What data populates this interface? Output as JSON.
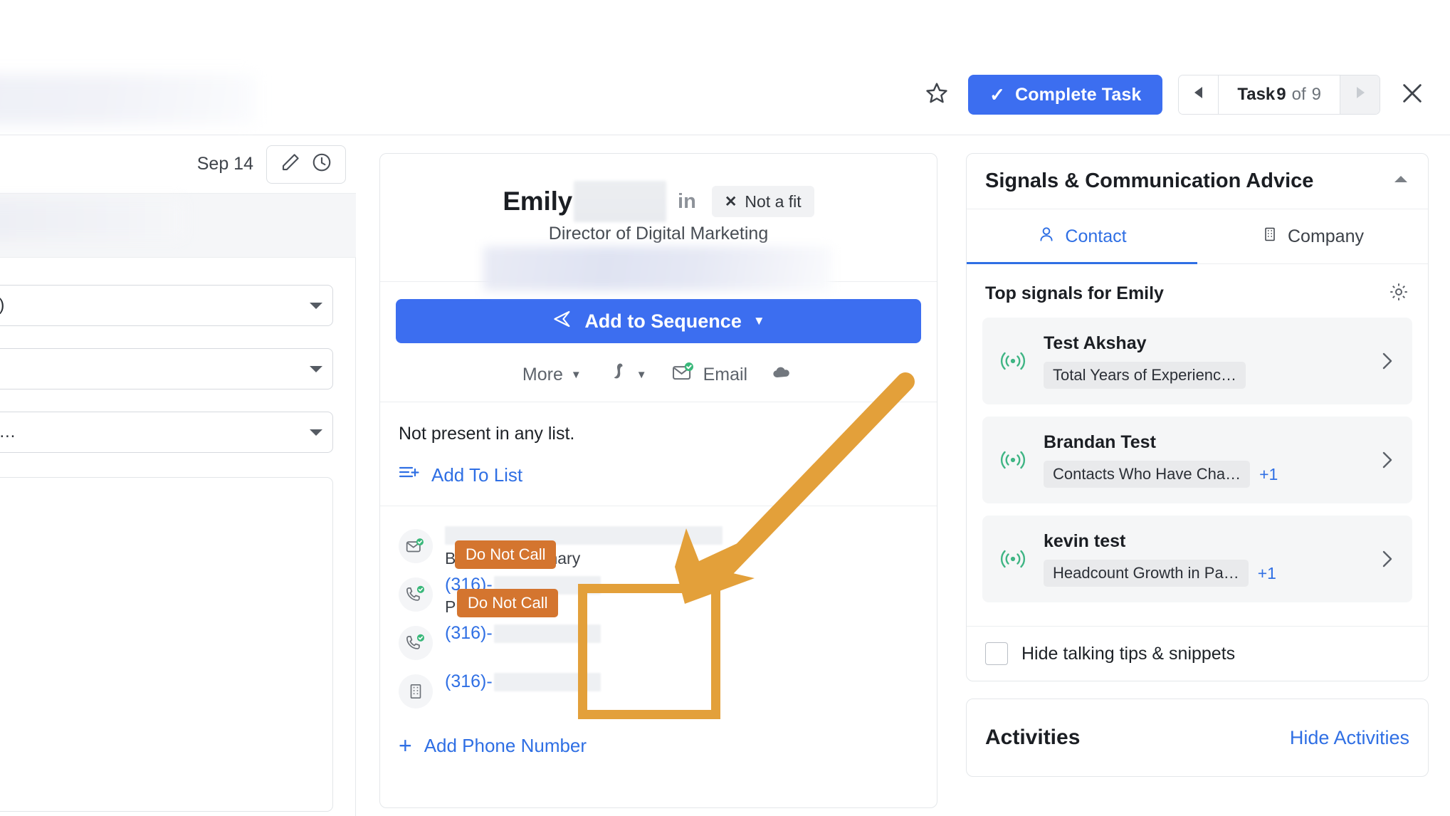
{
  "header": {
    "star_icon": "star-outline-icon",
    "complete_task_label": "Complete Task",
    "complete_task_check": "✓",
    "task_prefix": "Task",
    "task_current": "9",
    "task_middle": "of",
    "task_total": "9",
    "prev_icon": "triangle-left-icon",
    "next_icon": "triangle-right-icon",
    "close_icon": "close-x-icon"
  },
  "left": {
    "date": "Sep 14",
    "edit_icon": "pencil-icon",
    "clock_icon": "clock-icon",
    "selects": [
      {
        "value": "u)",
        "caret": "caret-down-icon"
      },
      {
        "value": "",
        "caret": "caret-down-icon"
      },
      {
        "value": "n…",
        "caret": "caret-down-icon"
      }
    ]
  },
  "contact_card": {
    "first_name": "Emily",
    "linkedin_icon": "in",
    "not_a_fit_label": "Not a fit",
    "not_a_fit_x": "✕",
    "job_title": "Director of Digital Marketing",
    "add_to_sequence_label": "Add to Sequence",
    "add_to_sequence_icon": "send-plane-icon",
    "caret": "▼",
    "mini_actions": [
      {
        "label": "More",
        "icon": "",
        "caret": "▼"
      },
      {
        "label": "",
        "icon": "salesforce-icon",
        "caret": "▼"
      },
      {
        "label": "Email",
        "icon": "email-verified-icon",
        "caret": ""
      },
      {
        "label": "",
        "icon": "cloud-icon",
        "caret": ""
      }
    ],
    "list_status": "Not present in any list.",
    "add_to_list_label": "Add To List",
    "add_to_list_icon": "list-add-icon",
    "contact_rows": [
      {
        "icon": "email-verified-circle-icon",
        "type": "email",
        "value_redacted": true,
        "sub_primary": "Business",
        "sub_sep": "·",
        "sub_secondary": "Primary"
      },
      {
        "icon": "phone-verified-circle-icon",
        "type": "phone",
        "prefix": "(316)-",
        "sub": "Primary",
        "badge": "Do Not Call"
      },
      {
        "icon": "phone-verified-circle-icon",
        "type": "phone",
        "prefix": "(316)-",
        "sub": "",
        "badge": "Do Not Call"
      },
      {
        "icon": "building-circle-icon",
        "type": "phone",
        "prefix": "(316)-",
        "sub": "",
        "badge": ""
      }
    ],
    "add_phone_label": "Add Phone Number",
    "add_phone_plus": "+"
  },
  "signals_panel": {
    "title": "Signals & Communication Advice",
    "collapse_icon": "triangle-up-icon",
    "tabs": [
      {
        "label": "Contact",
        "icon": "person-icon",
        "active": true
      },
      {
        "label": "Company",
        "icon": "building-icon",
        "active": false
      }
    ],
    "section_title": "Top signals for Emily",
    "settings_icon": "gear-icon",
    "signals": [
      {
        "name": "Test Akshay",
        "tag": "Total Years of Experienc…",
        "extra": "",
        "chevron": "chevron-right-icon",
        "icon": "broadcast-icon"
      },
      {
        "name": "Brandan Test",
        "tag": "Contacts Who Have Cha…",
        "extra": "+1",
        "chevron": "chevron-right-icon",
        "icon": "broadcast-icon"
      },
      {
        "name": "kevin test",
        "tag": "Headcount Growth in Pa…",
        "extra": "+1",
        "chevron": "chevron-right-icon",
        "icon": "broadcast-icon"
      }
    ],
    "hide_tips_label": "Hide talking tips & snippets",
    "hide_tips_checked": false
  },
  "activities": {
    "title": "Activities",
    "hide_link": "Hide Activities"
  },
  "annotation": {
    "arrow_color": "#e3a03a",
    "box_color": "#e3a03a",
    "badge_color": "#d4752f"
  }
}
